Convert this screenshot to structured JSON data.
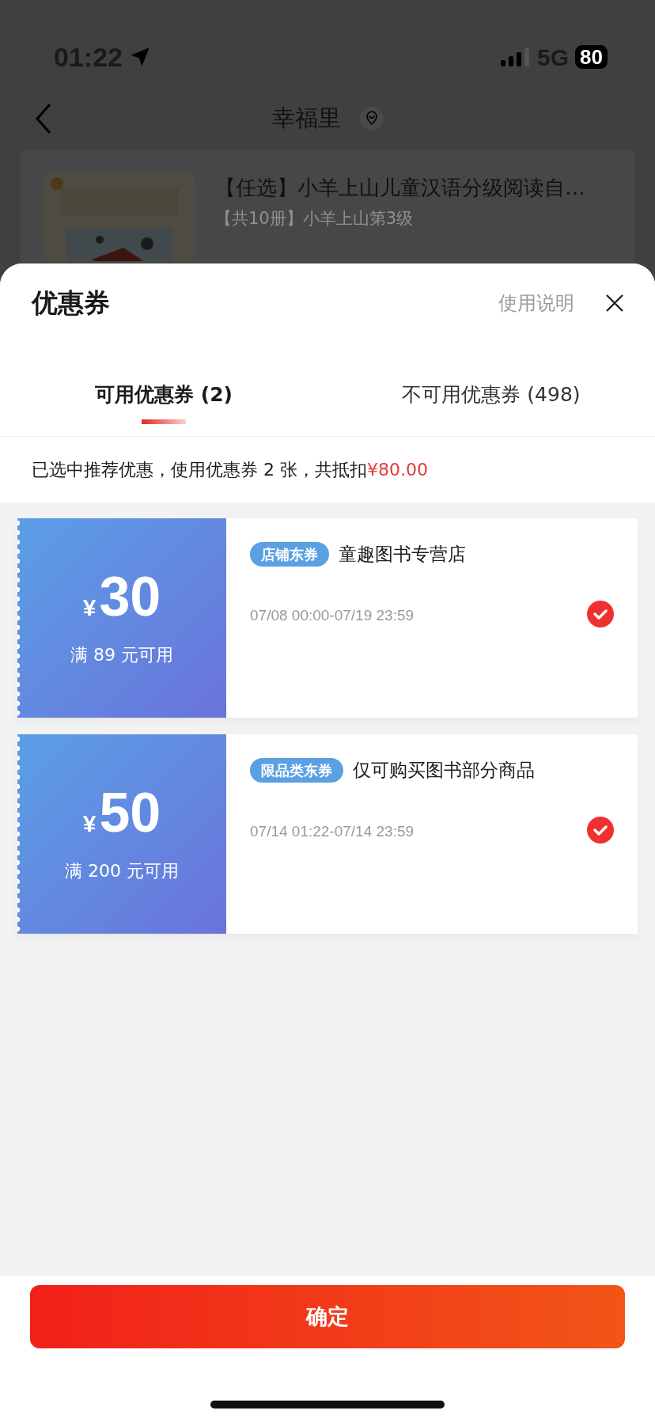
{
  "status_bar": {
    "time": "01:22",
    "network": "5G",
    "battery": "80"
  },
  "header": {
    "title": "幸福里"
  },
  "product": {
    "title": "【任选】小羊上山儿童汉语分级阅读自…",
    "subtitle": "【共10册】小羊上山第3级"
  },
  "sheet": {
    "title": "优惠券",
    "help_link": "使用说明",
    "tabs": [
      {
        "label": "可用优惠券 (2)",
        "selected": true
      },
      {
        "label": "不可用优惠券 (498)",
        "selected": false
      }
    ],
    "summary": {
      "text": "已选中推荐优惠，使用优惠券 2 张，共抵扣",
      "amount": "¥80.00"
    },
    "coupons": [
      {
        "currency": "¥",
        "amount": "30",
        "condition": "满 89 元可用",
        "tag": "店铺东券",
        "name": "童趣图书专营店",
        "validity": "07/08 00:00-07/19 23:59",
        "selected": true
      },
      {
        "currency": "¥",
        "amount": "50",
        "condition": "满 200 元可用",
        "tag": "限品类东券",
        "name": "仅可购买图书部分商品",
        "validity": "07/14 01:22-07/14 23:59",
        "selected": true
      }
    ],
    "confirm_button": "确定"
  }
}
